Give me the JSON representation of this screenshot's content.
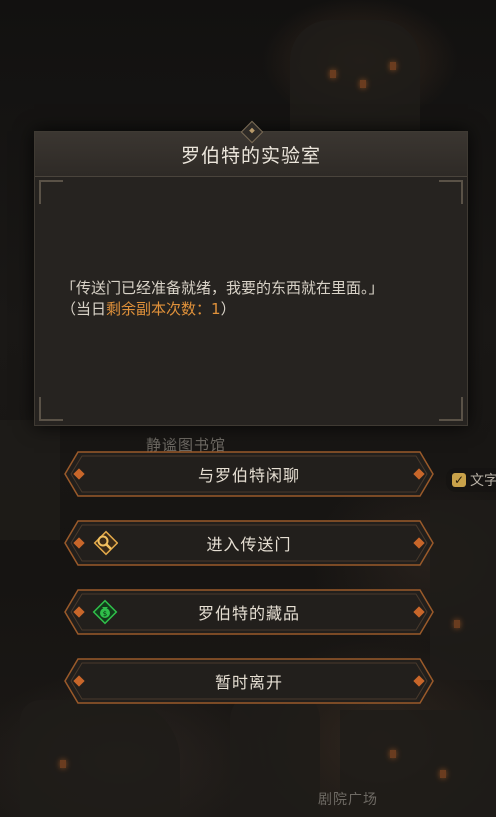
{
  "dialog": {
    "title": "罗伯特的实验室",
    "text_line1": "「传送门已经准备就绪，我要的东西就在里面。」",
    "text_line2_prefix": "（当日",
    "text_line2_highlight": "剩余副本次数：1",
    "text_line2_suffix": "）"
  },
  "options": [
    {
      "label": "与罗伯特闲聊",
      "icon": "none"
    },
    {
      "label": "进入传送门",
      "icon": "magnifier-icon"
    },
    {
      "label": "罗伯特的藏品",
      "icon": "money-bag-icon"
    },
    {
      "label": "暂时离开",
      "icon": "none"
    }
  ],
  "background": {
    "location_partial": "静谧图书馆",
    "side_toggle": "文字",
    "bottom_location": "剧院广场"
  },
  "colors": {
    "highlight": "#e0913a",
    "panel": "#262320",
    "button_border": "#9a5a2a",
    "bag_icon": "#2fbf4a"
  }
}
